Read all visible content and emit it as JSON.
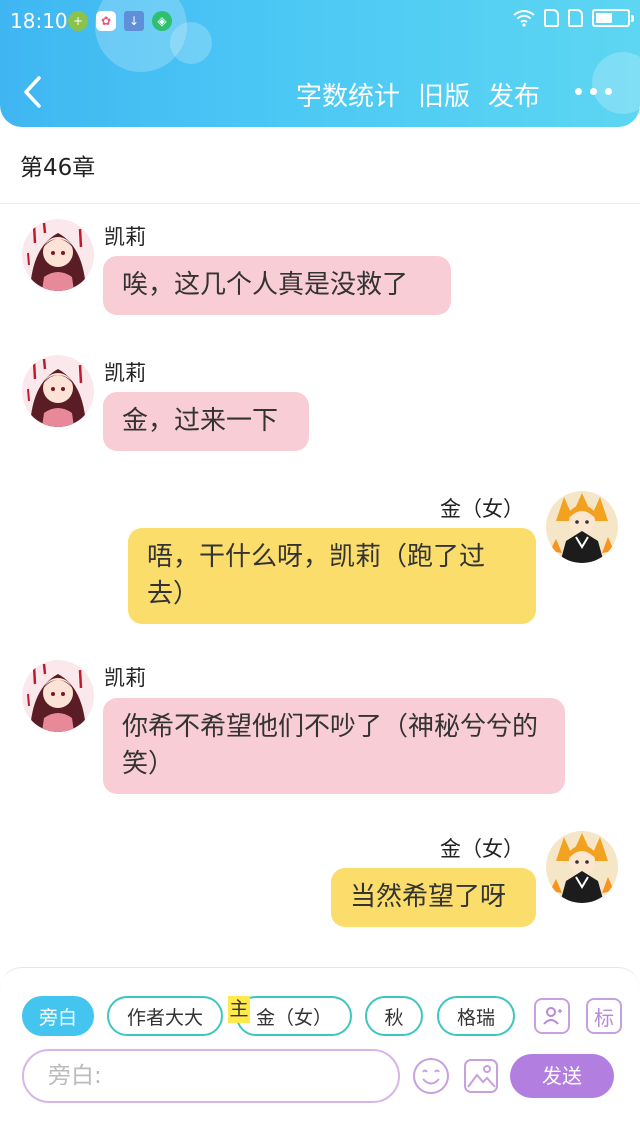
{
  "status_bar": {
    "time": "18:10"
  },
  "nav": {
    "actions": [
      "字数统计",
      "旧版",
      "发布"
    ]
  },
  "chapter": {
    "title": "第46章"
  },
  "messages": [
    {
      "speaker": "凯莉",
      "text": "唉，这几个人真是没救了",
      "side": "left"
    },
    {
      "speaker": "凯莉",
      "text": "金，过来一下",
      "side": "left"
    },
    {
      "speaker": "金（女）",
      "text": "唔，干什么呀，凯莉（跑了过去）",
      "side": "right"
    },
    {
      "speaker": "凯莉",
      "text": "你希不希望他们不吵了（神秘兮兮的笑）",
      "side": "left"
    },
    {
      "speaker": "金（女）",
      "text": "当然希望了呀",
      "side": "right"
    }
  ],
  "roles": [
    "旁白",
    "作者大大",
    "金（女）",
    "秋",
    "格瑞"
  ],
  "host_tag": "主",
  "tools": {
    "mark": "标"
  },
  "composer": {
    "placeholder": "旁白:",
    "send_label": "发送"
  },
  "colors": {
    "header": "#4cc8f4",
    "left_bubble": "#f9cdd6",
    "right_bubble": "#fbdd6c",
    "accent": "#b27ee0",
    "chip_border": "#3ec6be"
  }
}
